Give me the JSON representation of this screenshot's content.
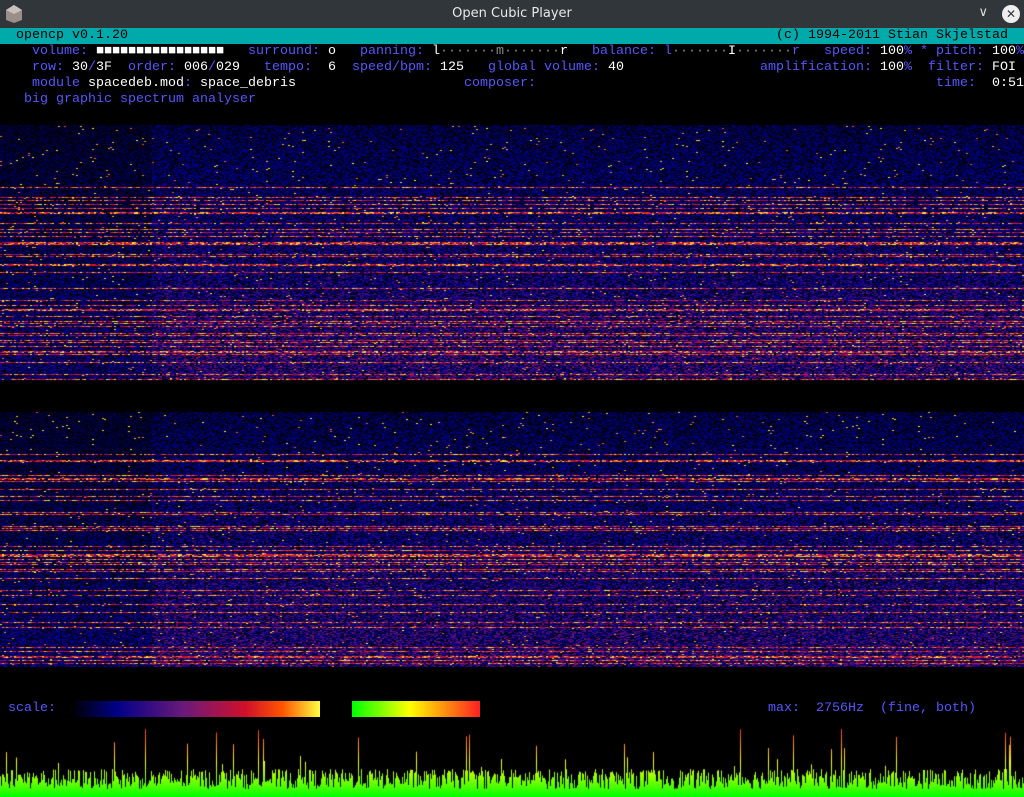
{
  "window": {
    "title": "Open Cubic Player",
    "minimize_icon": "chevron-down-icon",
    "close_icon": "close-icon"
  },
  "header": {
    "left": "opencp v0.1.20",
    "right": "(c) 1994-2011 Stian Skjelstad"
  },
  "status": {
    "row1": [
      {
        "col": 4,
        "cls": "lb",
        "text": "volume:"
      },
      {
        "col": 12,
        "cls": "vl",
        "text": "■■■■■■■■■■■■■■■■"
      },
      {
        "col": 31,
        "cls": "lb",
        "text": "surround:"
      },
      {
        "col": 41,
        "cls": "vl",
        "text": "o"
      },
      {
        "col": 45,
        "cls": "lb",
        "text": "panning:"
      },
      {
        "col": 54,
        "cls": "vl",
        "text": "l"
      },
      {
        "col": 55,
        "cls": "dm",
        "text": "·······"
      },
      {
        "col": 62,
        "cls": "dm",
        "text": "m"
      },
      {
        "col": 63,
        "cls": "dm",
        "text": "·······"
      },
      {
        "col": 70,
        "cls": "vl",
        "text": "r"
      },
      {
        "col": 74,
        "cls": "lb",
        "text": "balance:"
      },
      {
        "col": 83,
        "cls": "lb",
        "text": "l"
      },
      {
        "col": 84,
        "cls": "dm",
        "text": "·······"
      },
      {
        "col": 91,
        "cls": "vl",
        "text": "I"
      },
      {
        "col": 92,
        "cls": "dm",
        "text": "·······"
      },
      {
        "col": 99,
        "cls": "lb",
        "text": "r"
      },
      {
        "col": 103,
        "cls": "lb",
        "text": "speed:"
      },
      {
        "col": 110,
        "cls": "vl",
        "text": "100"
      },
      {
        "col": 113,
        "cls": "lb",
        "text": "%"
      },
      {
        "col": 115,
        "cls": "lb",
        "text": "* pitch:"
      },
      {
        "col": 124,
        "cls": "vl",
        "text": "100"
      },
      {
        "col": 127,
        "cls": "lb",
        "text": "%"
      }
    ],
    "row2": [
      {
        "col": 4,
        "cls": "lb",
        "text": "row:"
      },
      {
        "col": 9,
        "cls": "vl",
        "text": "30"
      },
      {
        "col": 11,
        "cls": "lb",
        "text": "/"
      },
      {
        "col": 12,
        "cls": "vl",
        "text": "3F"
      },
      {
        "col": 16,
        "cls": "lb",
        "text": "order:"
      },
      {
        "col": 23,
        "cls": "vl",
        "text": "006"
      },
      {
        "col": 26,
        "cls": "lb",
        "text": "/"
      },
      {
        "col": 27,
        "cls": "vl",
        "text": "029"
      },
      {
        "col": 33,
        "cls": "lb",
        "text": "tempo:"
      },
      {
        "col": 41,
        "cls": "vl",
        "text": "6"
      },
      {
        "col": 44,
        "cls": "lb",
        "text": "speed/bpm:"
      },
      {
        "col": 55,
        "cls": "vl",
        "text": "125"
      },
      {
        "col": 61,
        "cls": "lb",
        "text": "global volume:"
      },
      {
        "col": 76,
        "cls": "vl",
        "text": "40"
      },
      {
        "col": 95,
        "cls": "lb",
        "text": "amplification:"
      },
      {
        "col": 110,
        "cls": "vl",
        "text": "100"
      },
      {
        "col": 113,
        "cls": "lb",
        "text": "%"
      },
      {
        "col": 116,
        "cls": "lb",
        "text": "filter:"
      },
      {
        "col": 124,
        "cls": "vl",
        "text": "FOI"
      }
    ],
    "row3": [
      {
        "col": 4,
        "cls": "lb",
        "text": "module"
      },
      {
        "col": 11,
        "cls": "vl",
        "text": "spacedeb.mod"
      },
      {
        "col": 23,
        "cls": "lb",
        "text": ":"
      },
      {
        "col": 25,
        "cls": "vl",
        "text": "space_debris"
      },
      {
        "col": 58,
        "cls": "lb",
        "text": "composer:"
      },
      {
        "col": 117,
        "cls": "lb",
        "text": "time:"
      },
      {
        "col": 124,
        "cls": "vl",
        "text": "0:51"
      }
    ],
    "row4": [
      {
        "col": 3,
        "cls": "lb",
        "text": "big graphic spectrum analyser"
      }
    ]
  },
  "footer": {
    "scale_label": "scale:",
    "max_label": "max:",
    "max_value": "2756Hz",
    "mode": "(fine, both)"
  },
  "colors": {
    "header_bg": "#00aaaa",
    "label": "#5555ff",
    "value": "#ffffff",
    "titlebar": "#31363b"
  }
}
